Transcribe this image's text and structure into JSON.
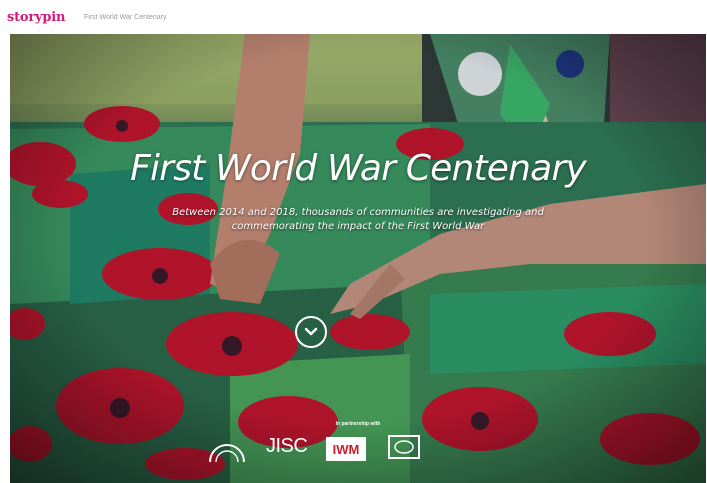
{
  "header": {
    "logo_text": "storypin",
    "breadcrumb": "First World War Centenary",
    "brand_color": "#d11a7a"
  },
  "hero": {
    "title": "First World War Centenary",
    "subtitle": "Between 2014 and 2018, thousands of communities are investigating and commemorating the impact of the First World War",
    "scroll_icon": "chevron-down-icon",
    "partner_label": "In partnership with",
    "partners": {
      "arch_logo_icon": "arch-logo-icon",
      "jisc_text": "JISC",
      "iwm_text": "IWM",
      "box_logo_icon": "box-logo-icon"
    }
  }
}
